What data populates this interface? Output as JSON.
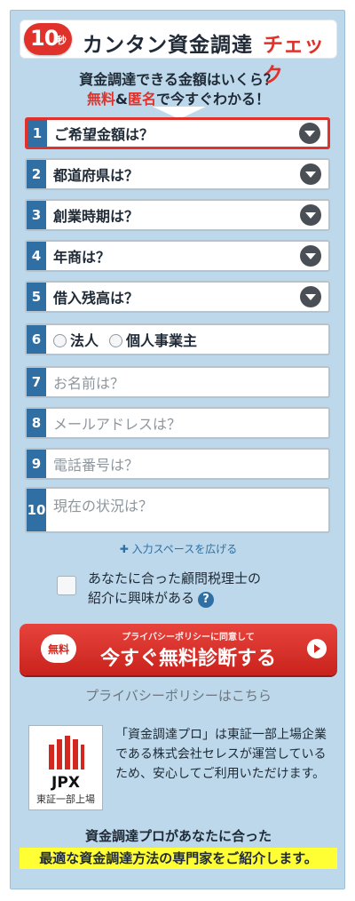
{
  "header": {
    "badge_number": "10",
    "badge_unit": "秒",
    "title_main": "カンタン資金調達",
    "title_accent": "チェック"
  },
  "subheading": {
    "line1": "資金調達できる金額はいくら？",
    "line2_a": "無料",
    "line2_b": "&",
    "line2_c": "匿名",
    "line2_d": "で今すぐわかる！"
  },
  "form": {
    "fields": [
      {
        "n": "1",
        "label": "ご希望金額は？",
        "type": "select"
      },
      {
        "n": "2",
        "label": "都道府県は？",
        "type": "select"
      },
      {
        "n": "3",
        "label": "創業時期は？",
        "type": "select"
      },
      {
        "n": "4",
        "label": "年商は？",
        "type": "select"
      },
      {
        "n": "5",
        "label": "借入残高は？",
        "type": "select"
      },
      {
        "n": "6",
        "label": "",
        "type": "radio",
        "options": [
          "法人",
          "個人事業主"
        ]
      },
      {
        "n": "7",
        "placeholder": "お名前は？",
        "type": "text"
      },
      {
        "n": "8",
        "placeholder": "メールアドレスは？",
        "type": "text"
      },
      {
        "n": "9",
        "placeholder": "電話番号は？",
        "type": "text"
      },
      {
        "n": "10",
        "placeholder": "現在の状況は？",
        "type": "textarea"
      }
    ],
    "expand_link": "✚ 入力スペースを広げる",
    "interest_line1": "あなたに合った顧問税理士の",
    "interest_line2": "紹介に興味がある",
    "help_icon_label": "?"
  },
  "cta": {
    "pill": "無料",
    "top_text": "プライバシーポリシーに同意して",
    "main_text": "今すぐ無料診断する"
  },
  "privacy_link": "プライバシーポリシーはこちら",
  "logo": {
    "name": "JPX",
    "caption": "東証一部上場"
  },
  "description": "「資金調達プロ」は東証一部上場企業である株式会社セレスが運営しているため、安心してご利用いただけます。",
  "footer": {
    "line1": "資金調達プロがあなたに合った",
    "line2": "最適な資金調達方法の専門家をご紹介します。"
  },
  "colors": {
    "accent": "#e0312a",
    "blue": "#2f6fa3",
    "panel": "#bcd8ea",
    "highlight": "#ffff33"
  }
}
